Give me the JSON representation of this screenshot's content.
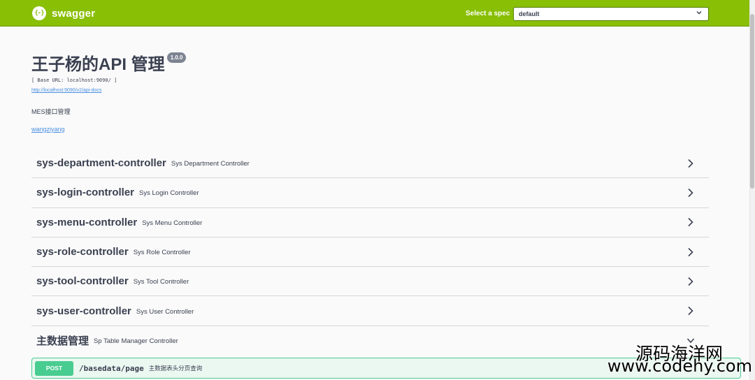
{
  "header": {
    "logo_glyph": "{-}",
    "logo_text": "swagger",
    "spec_label": "Select a spec",
    "spec_selected": "default",
    "color": "#89bf04"
  },
  "info": {
    "title": "王子杨的API 管理",
    "version": "1.0.0",
    "base_url": "[ Base URL: localhost:9090/ ]",
    "docs_url": "http://localhost:9090/v2/api-docs",
    "description": "MES接口管理",
    "author": "wangziyang"
  },
  "tags": [
    {
      "name": "sys-department-controller",
      "description": "Sys Department Controller"
    },
    {
      "name": "sys-login-controller",
      "description": "Sys Login Controller"
    },
    {
      "name": "sys-menu-controller",
      "description": "Sys Menu Controller"
    },
    {
      "name": "sys-role-controller",
      "description": "Sys Role Controller"
    },
    {
      "name": "sys-tool-controller",
      "description": "Sys Tool Controller"
    },
    {
      "name": "sys-user-controller",
      "description": "Sys User Controller"
    },
    {
      "name": "主数据管理",
      "description": "Sp Table Manager Controller"
    }
  ],
  "operation": {
    "method": "POST",
    "path": "/basedata/page",
    "summary": "主数据表头分页查询",
    "color": "#49cc90"
  },
  "watermark": {
    "cn": "源码海洋网",
    "url": "www.codehy.com"
  }
}
